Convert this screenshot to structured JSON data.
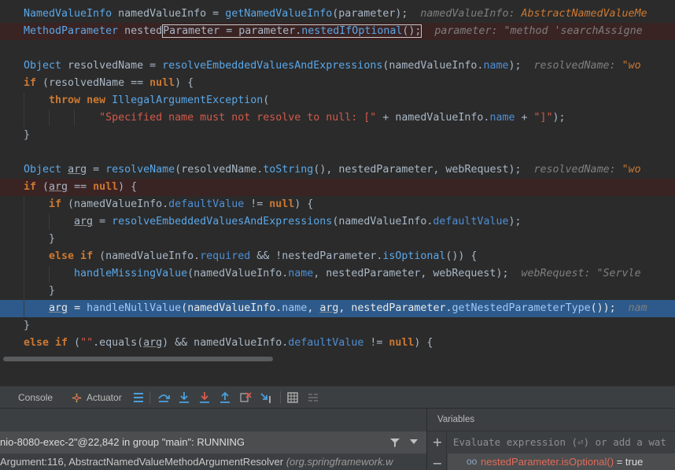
{
  "editor": {
    "lines": [
      {
        "kind": "normal",
        "indent": 0,
        "tokens": [
          {
            "t": "NamedValueInfo",
            "c": "t-ty"
          },
          {
            "t": " namedValueInfo = ",
            "c": "t-p"
          },
          {
            "t": "getNamedValueInfo",
            "c": "t-fn"
          },
          {
            "t": "(parameter);",
            "c": "t-p"
          },
          {
            "t": "  namedValueInfo: ",
            "c": "t-cmt"
          },
          {
            "t": "AbstractNamedValueMe",
            "c": "t-cmtv"
          }
        ]
      },
      {
        "kind": "bp",
        "indent": 0,
        "tokens": [
          {
            "t": "MethodParameter",
            "c": "t-ty"
          },
          {
            "t": " nested",
            "c": "t-p"
          },
          {
            "t": "Parameter = parameter.",
            "c": "t-p",
            "box": "start"
          },
          {
            "t": "nestedIfOptional",
            "c": "t-fn"
          },
          {
            "t": "();",
            "c": "t-p",
            "box": "end"
          },
          {
            "t": "  parameter: ",
            "c": "t-cmt"
          },
          {
            "t": "\"method 'searchAssigne",
            "c": "t-cmts"
          }
        ]
      },
      {
        "kind": "normal",
        "indent": 0,
        "tokens": []
      },
      {
        "kind": "normal",
        "indent": 0,
        "tokens": [
          {
            "t": "Object",
            "c": "t-ty"
          },
          {
            "t": " resolvedName = ",
            "c": "t-p"
          },
          {
            "t": "resolveEmbeddedValuesAndExpressions",
            "c": "t-fn"
          },
          {
            "t": "(namedValueInfo.",
            "c": "t-p"
          },
          {
            "t": "name",
            "c": "t-fld"
          },
          {
            "t": ");",
            "c": "t-p"
          },
          {
            "t": "  resolvedName: ",
            "c": "t-cmt"
          },
          {
            "t": "\"wo",
            "c": "t-cmtv"
          }
        ]
      },
      {
        "kind": "normal",
        "indent": 0,
        "tokens": [
          {
            "t": "if",
            "c": "t-kw"
          },
          {
            "t": " (resolvedName == ",
            "c": "t-p"
          },
          {
            "t": "null",
            "c": "t-kw"
          },
          {
            "t": ") {",
            "c": "t-p"
          }
        ]
      },
      {
        "kind": "normal",
        "indent": 1,
        "tokens": [
          {
            "t": "throw new ",
            "c": "t-kw"
          },
          {
            "t": "IllegalArgumentException",
            "c": "t-ty"
          },
          {
            "t": "(",
            "c": "t-p"
          }
        ]
      },
      {
        "kind": "normal",
        "indent": 3,
        "tokens": [
          {
            "t": "\"Specified name must not resolve to null: [\"",
            "c": "t-str"
          },
          {
            "t": " + namedValueInfo.",
            "c": "t-p"
          },
          {
            "t": "name",
            "c": "t-fld"
          },
          {
            "t": " + ",
            "c": "t-p"
          },
          {
            "t": "\"]\"",
            "c": "t-str"
          },
          {
            "t": ");",
            "c": "t-p"
          }
        ]
      },
      {
        "kind": "normal",
        "indent": 0,
        "tokens": [
          {
            "t": "}",
            "c": "t-p"
          }
        ]
      },
      {
        "kind": "normal",
        "indent": 0,
        "tokens": []
      },
      {
        "kind": "normal",
        "indent": 0,
        "tokens": [
          {
            "t": "Object",
            "c": "t-ty"
          },
          {
            "t": " ",
            "c": "t-p"
          },
          {
            "t": "arg",
            "c": "t-var"
          },
          {
            "t": " = ",
            "c": "t-p"
          },
          {
            "t": "resolveName",
            "c": "t-fn"
          },
          {
            "t": "(resolvedName.",
            "c": "t-p"
          },
          {
            "t": "toString",
            "c": "t-fn"
          },
          {
            "t": "(), nestedParameter, webRequest);",
            "c": "t-p"
          },
          {
            "t": "  resolvedName: ",
            "c": "t-cmt"
          },
          {
            "t": "\"wo",
            "c": "t-cmtv"
          }
        ]
      },
      {
        "kind": "bp",
        "indent": 0,
        "tokens": [
          {
            "t": "if",
            "c": "t-kw"
          },
          {
            "t": " (",
            "c": "t-p"
          },
          {
            "t": "arg",
            "c": "t-var"
          },
          {
            "t": " == ",
            "c": "t-p"
          },
          {
            "t": "null",
            "c": "t-kw"
          },
          {
            "t": ") {",
            "c": "t-p"
          }
        ]
      },
      {
        "kind": "normal",
        "indent": 1,
        "tokens": [
          {
            "t": "if",
            "c": "t-kw"
          },
          {
            "t": " (namedValueInfo.",
            "c": "t-p"
          },
          {
            "t": "defaultValue",
            "c": "t-fld"
          },
          {
            "t": " != ",
            "c": "t-p"
          },
          {
            "t": "null",
            "c": "t-kw"
          },
          {
            "t": ") {",
            "c": "t-p"
          }
        ]
      },
      {
        "kind": "normal",
        "indent": 2,
        "tokens": [
          {
            "t": "arg",
            "c": "t-var"
          },
          {
            "t": " = ",
            "c": "t-p"
          },
          {
            "t": "resolveEmbeddedValuesAndExpressions",
            "c": "t-fn"
          },
          {
            "t": "(namedValueInfo.",
            "c": "t-p"
          },
          {
            "t": "defaultValue",
            "c": "t-fld"
          },
          {
            "t": ");",
            "c": "t-p"
          }
        ]
      },
      {
        "kind": "normal",
        "indent": 1,
        "tokens": [
          {
            "t": "}",
            "c": "t-p"
          }
        ]
      },
      {
        "kind": "normal",
        "indent": 1,
        "tokens": [
          {
            "t": "else if",
            "c": "t-kw"
          },
          {
            "t": " (namedValueInfo.",
            "c": "t-p"
          },
          {
            "t": "required",
            "c": "t-fld"
          },
          {
            "t": " && !nestedParameter.",
            "c": "t-p"
          },
          {
            "t": "isOptional",
            "c": "t-fn"
          },
          {
            "t": "()) {",
            "c": "t-p"
          }
        ]
      },
      {
        "kind": "normal",
        "indent": 2,
        "tokens": [
          {
            "t": "handleMissingValue",
            "c": "t-fn"
          },
          {
            "t": "(namedValueInfo.",
            "c": "t-p"
          },
          {
            "t": "name",
            "c": "t-fld"
          },
          {
            "t": ", nestedParameter, webRequest);",
            "c": "t-p"
          },
          {
            "t": "  webRequest: ",
            "c": "t-cmt"
          },
          {
            "t": "\"Servle",
            "c": "t-cmts"
          }
        ]
      },
      {
        "kind": "normal",
        "indent": 1,
        "tokens": [
          {
            "t": "}",
            "c": "t-p"
          }
        ]
      },
      {
        "kind": "exec",
        "indent": 1,
        "tokens": [
          {
            "t": "arg",
            "c": "t-var"
          },
          {
            "t": " = ",
            "c": "t-p"
          },
          {
            "t": "handleNullValue",
            "c": "t-fn"
          },
          {
            "t": "(namedValueInfo.",
            "c": "t-p"
          },
          {
            "t": "name",
            "c": "t-fld"
          },
          {
            "t": ", ",
            "c": "t-p"
          },
          {
            "t": "arg",
            "c": "t-var"
          },
          {
            "t": ", nestedParameter.",
            "c": "t-p"
          },
          {
            "t": "getNestedParameterType",
            "c": "t-fn"
          },
          {
            "t": "());",
            "c": "t-p"
          },
          {
            "t": "  nam",
            "c": "t-cmt"
          }
        ]
      },
      {
        "kind": "normal",
        "indent": 0,
        "tokens": [
          {
            "t": "}",
            "c": "t-p"
          }
        ]
      },
      {
        "kind": "normal",
        "indent": 0,
        "tokens": [
          {
            "t": "else if",
            "c": "t-kw"
          },
          {
            "t": " (",
            "c": "t-p"
          },
          {
            "t": "\"\"",
            "c": "t-str"
          },
          {
            "t": ".equals(",
            "c": "t-p"
          },
          {
            "t": "arg",
            "c": "t-var"
          },
          {
            "t": ") && namedValueInfo.",
            "c": "t-p"
          },
          {
            "t": "defaultValue",
            "c": "t-fld"
          },
          {
            "t": " != ",
            "c": "t-p"
          },
          {
            "t": "null",
            "c": "t-kw"
          },
          {
            "t": ") {",
            "c": "t-p"
          }
        ]
      }
    ]
  },
  "toolbar": {
    "tabs": [
      {
        "label": "Console",
        "icon": ""
      },
      {
        "label": "Actuator",
        "icon": "actuator-icon"
      }
    ],
    "icons": [
      "frames-list-icon",
      "show-execution-point-icon",
      "step-over-icon",
      "step-into-icon",
      "force-step-into-icon",
      "step-out-icon",
      "drop-frame-icon",
      "run-to-cursor-icon",
      "evaluate-icon",
      "trace-icon"
    ]
  },
  "frames": {
    "thread": "nio-8080-exec-2\"@22,842 in group \"main\": RUNNING",
    "frame_method": "Argument:116, AbstractNamedValueMethodArgumentResolver ",
    "frame_package": "(org.springframework.w"
  },
  "variables": {
    "title": "Variables",
    "eval_placeholder": "Evaluate expression (⏎) or add a wat",
    "watch_expr": "nestedParameter.isOptional()",
    "watch_value": " = true",
    "watch_icon": "oo"
  },
  "colors": {
    "editor_bg": "#2b2b2b",
    "breakpoint_line": "#3a2323",
    "execution_line": "#2d5a8a",
    "panel_bg": "#3c3f41",
    "selected_row": "#4b4d4f",
    "icon_blue": "#4a9fdc",
    "icon_red": "#d65c4f"
  }
}
